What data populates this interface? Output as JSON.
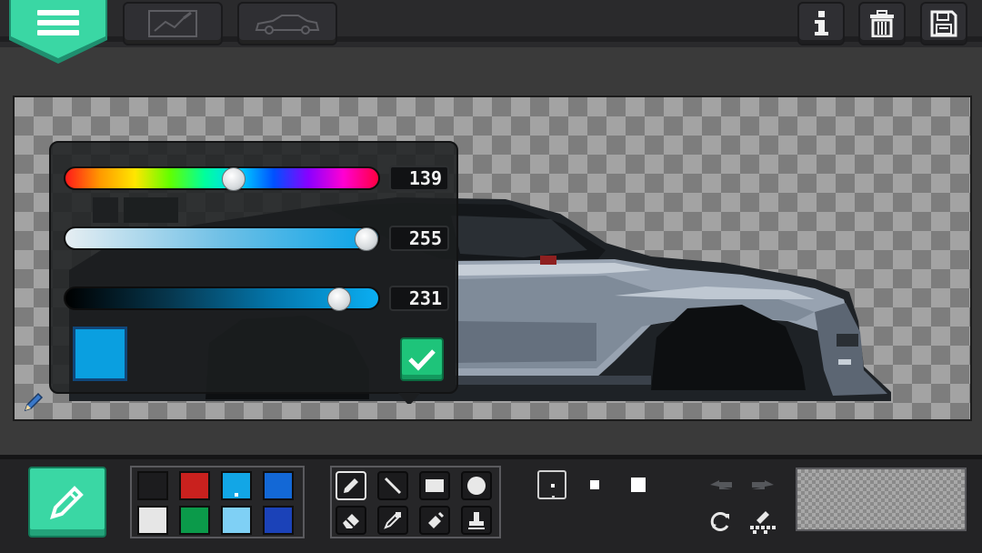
{
  "color_picker": {
    "hue": {
      "value": "139",
      "fraction": 0.54
    },
    "saturation": {
      "value": "255",
      "fraction": 1.0
    },
    "brightness": {
      "value": "231",
      "fraction": 0.906
    },
    "current_color": "#0a9fe0"
  },
  "palette": {
    "colors": [
      "#1c1c1e",
      "#c9211e",
      "#12a6e6",
      "#1368d6",
      "#e6e6e6",
      "#0b9a4a",
      "#7fd0f5",
      "#1b42b8"
    ],
    "selected_index": 2
  },
  "tools": [
    "pencil-icon",
    "line-icon",
    "rectangle-icon",
    "circle-icon",
    "eraser-icon",
    "eyedropper-icon",
    "fill-icon",
    "stamp-icon"
  ],
  "selected_tool": "pencil-icon",
  "top_right": [
    "info-icon",
    "trash-icon",
    "save-icon"
  ],
  "accent": "#3ad7a4",
  "confirm_color": "#1ec47a"
}
